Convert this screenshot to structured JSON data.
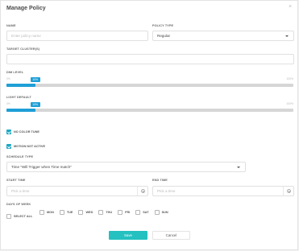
{
  "dialog": {
    "title": "Manage Policy",
    "close_glyph": "×"
  },
  "name": {
    "label": "NAME",
    "placeholder": "Enter policy name"
  },
  "policy_type": {
    "label": "POLICY TYPE",
    "value": "Regular"
  },
  "target_clusters": {
    "label": "TARGET CLUSTER(S)"
  },
  "dim_level": {
    "label": "DIM LEVEL",
    "min": "0%",
    "max": "100%",
    "value_label": "10%",
    "value_percent": 10
  },
  "light_default": {
    "label": "LIGHT DEFAULT",
    "min": "0%",
    "max": "100%",
    "value_label": "10%",
    "value_percent": 10
  },
  "no_color_tune": {
    "label": "NO COLOR TUNE",
    "checked": true
  },
  "motion_not_active": {
    "label": "MOTION NOT ACTIVE",
    "checked": true
  },
  "schedule_type": {
    "label": "SCHEDULE TYPE",
    "value": "Time \"Will Trigger when Time match\""
  },
  "start_time": {
    "label": "START TIME",
    "placeholder": "Pick a time"
  },
  "end_time": {
    "label": "END TIME",
    "placeholder": "Pick a time"
  },
  "days_of_week": {
    "label": "DAYS OF WEEK",
    "select_all": "SELECT ALL",
    "days": [
      "MON",
      "TUE",
      "WED",
      "THU",
      "FRI",
      "SAT",
      "SUN"
    ]
  },
  "actions": {
    "save": "Save",
    "cancel": "Cancel"
  },
  "colors": {
    "accent": "#1e9fd6",
    "save_button": "#24c1c0",
    "checkbox": "#1ea7c4"
  }
}
